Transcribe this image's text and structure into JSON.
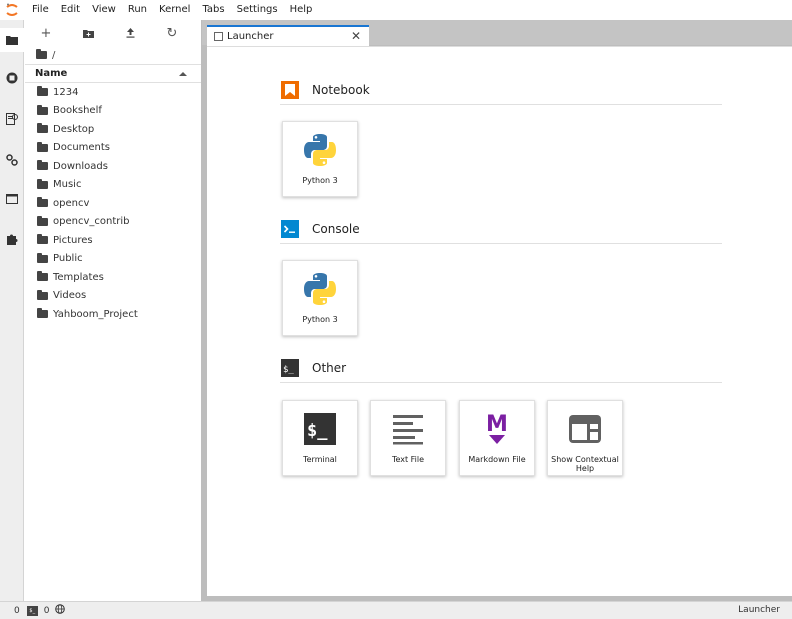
{
  "menubar": {
    "items": [
      "File",
      "Edit",
      "View",
      "Run",
      "Kernel",
      "Tabs",
      "Settings",
      "Help"
    ]
  },
  "activitybar": {
    "icons": [
      "folder-icon",
      "running-icon",
      "commands-icon",
      "property-inspector-icon",
      "tabs-icon",
      "extension-icon"
    ]
  },
  "filebrowser": {
    "toolbar": [
      "new-launcher-icon",
      "new-folder-icon",
      "upload-icon",
      "refresh-icon"
    ],
    "new_label": "+",
    "refresh_label": "↻",
    "breadcrumb": "/",
    "column_name": "Name",
    "items": [
      "1234",
      "Bookshelf",
      "Desktop",
      "Documents",
      "Downloads",
      "Music",
      "opencv",
      "opencv_contrib",
      "Pictures",
      "Public",
      "Templates",
      "Videos",
      "Yahboom_Project"
    ]
  },
  "tabs": [
    {
      "label": "Launcher",
      "close": "✕"
    }
  ],
  "launcher": {
    "sections": [
      {
        "title": "Notebook",
        "cards": [
          {
            "label": "Python 3"
          }
        ]
      },
      {
        "title": "Console",
        "cards": [
          {
            "label": "Python 3"
          }
        ]
      },
      {
        "title": "Other",
        "cards": [
          {
            "label": "Terminal"
          },
          {
            "label": "Text File"
          },
          {
            "label": "Markdown File"
          },
          {
            "label": "Show Contextual Help"
          }
        ]
      }
    ],
    "console_glyph": ">_",
    "terminal_glyph": "$_",
    "markdown_glyph": "M"
  },
  "statusbar": {
    "left_count": "0",
    "terminal_glyph": "$_",
    "kernel_count": "0",
    "right_label": "Launcher"
  },
  "colors": {
    "accent": "#1976d2",
    "notebook": "#ef6c00",
    "console": "#0288d1",
    "markdown": "#7b1fa2",
    "jupyter_orange": "#f37726"
  }
}
